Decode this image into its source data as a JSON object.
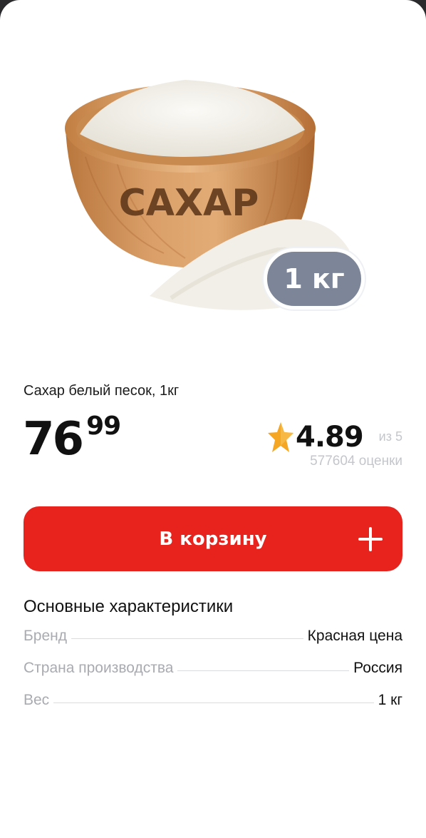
{
  "product": {
    "bowl_label": "САХАР",
    "weight_badge": "1 кг",
    "title": "Сахар белый песок, 1кг",
    "price_main": "76",
    "price_cents": "99"
  },
  "rating": {
    "value": "4.89",
    "scale": "из 5",
    "count": "577604 оценки"
  },
  "cart": {
    "label": "В корзину"
  },
  "specs": {
    "title": "Основные характеристики",
    "rows": [
      {
        "label": "Бренд",
        "value": "Красная цена"
      },
      {
        "label": "Страна производства",
        "value": "Россия"
      },
      {
        "label": "Вес",
        "value": "1 кг"
      }
    ]
  },
  "colors": {
    "accent": "#e8231d",
    "badge": "#7d8598",
    "star": "#f5a623",
    "muted": "#c4c6cc"
  },
  "icons": [
    "star-icon",
    "plus-icon"
  ]
}
